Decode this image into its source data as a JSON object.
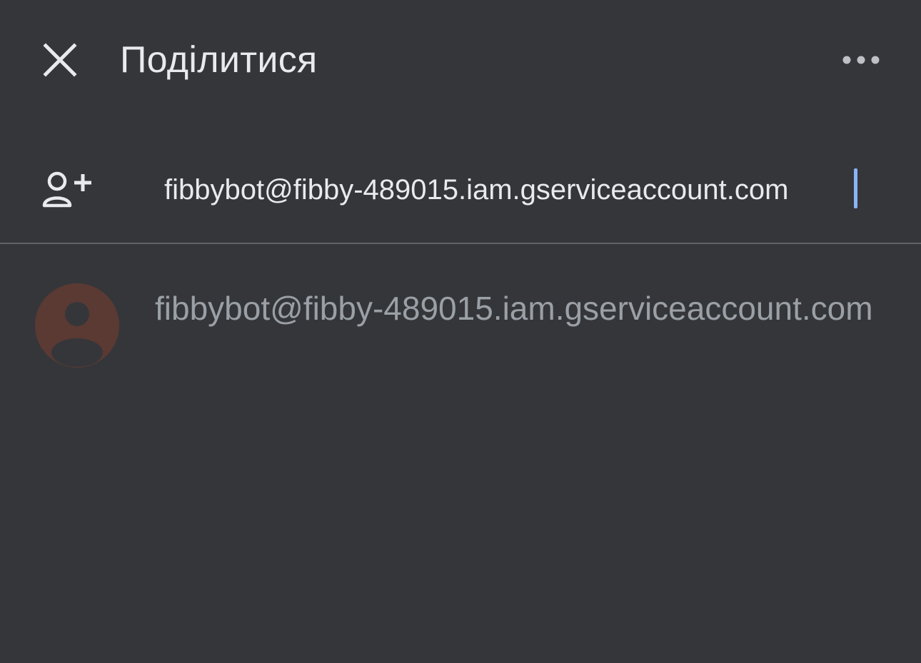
{
  "header": {
    "title": "Поділитися",
    "close_icon": "close-icon",
    "more_icon": "more-horizontal-icon"
  },
  "add_people": {
    "icon": "person-add-icon",
    "input_value": "fibbybot@fibby-489015.iam.gserviceaccount.com",
    "caret_color": "#8ab4f8"
  },
  "suggestions": [
    {
      "email": "fibbybot@fibby-489015.iam.gserviceaccount.com",
      "avatar_icon": "default-avatar-icon",
      "avatar_color": "#5b3a33"
    }
  ],
  "colors": {
    "background": "#35363a",
    "text_primary": "#e8eaed",
    "text_secondary": "#9aa0a6",
    "divider": "#5f6368"
  }
}
